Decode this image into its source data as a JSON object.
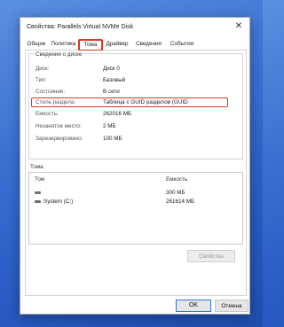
{
  "dialog": {
    "title": "Свойства: Parallels Virtual NVMe Disk",
    "close_glyph": "✕"
  },
  "tabs": [
    {
      "label": "Общие"
    },
    {
      "label": "Политика"
    },
    {
      "label": "Тома",
      "active": true
    },
    {
      "label": "Драйвер"
    },
    {
      "label": "Сведения"
    },
    {
      "label": "События"
    }
  ],
  "disk_info": {
    "group_title": "Сведения о диске",
    "rows": [
      {
        "label": "Диск:",
        "value": "Диск 0"
      },
      {
        "label": "Тип:",
        "value": "Базовый"
      },
      {
        "label": "Состояние:",
        "value": "В сети"
      },
      {
        "label": "Стиль раздела:",
        "value": "Таблица с GUID разделов (GUID",
        "highlighted": true
      },
      {
        "label": "Емкость:",
        "value": "262016 МБ"
      },
      {
        "label": "Незанятое место:",
        "value": "2 МБ"
      },
      {
        "label": "Зарезервировано:",
        "value": "100 МБ"
      }
    ]
  },
  "volumes": {
    "section_label": "Тома",
    "col_volume": "Том",
    "col_capacity": "Емкость",
    "items": [
      {
        "name": "",
        "capacity": "300 МБ",
        "icon": "disk-icon"
      },
      {
        "name": "System (C:)",
        "capacity": "261614 МБ",
        "icon": "disk-icon"
      }
    ]
  },
  "buttons": {
    "properties": "Свойства",
    "ok": "OK",
    "cancel": "Отмена"
  },
  "colors": {
    "highlight": "#d93a1e",
    "ok_border": "#2a78d6",
    "desktop": "#2f6fd6"
  }
}
